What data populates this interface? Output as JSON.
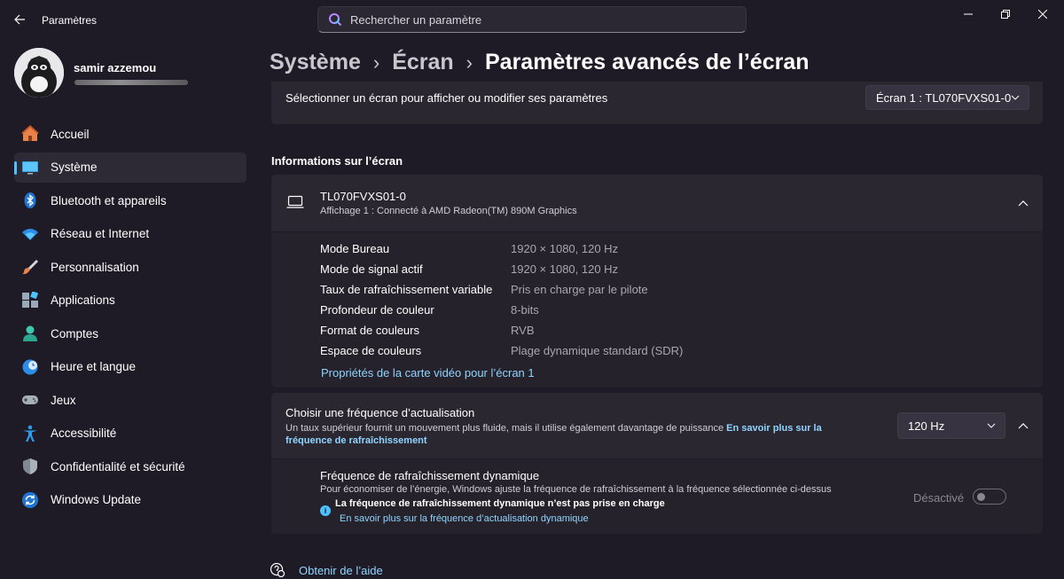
{
  "app": {
    "title": "Paramètres"
  },
  "search": {
    "placeholder": "Rechercher un paramètre"
  },
  "user": {
    "name": "samir azzemou"
  },
  "sidebar": {
    "items": [
      {
        "label": "Accueil",
        "icon": "home-icon"
      },
      {
        "label": "Système",
        "icon": "monitor-icon",
        "active": true
      },
      {
        "label": "Bluetooth et appareils",
        "icon": "bluetooth-icon"
      },
      {
        "label": "Réseau et Internet",
        "icon": "wifi-icon"
      },
      {
        "label": "Personnalisation",
        "icon": "brush-icon"
      },
      {
        "label": "Applications",
        "icon": "apps-icon"
      },
      {
        "label": "Comptes",
        "icon": "person-icon"
      },
      {
        "label": "Heure et langue",
        "icon": "globe-clock-icon"
      },
      {
        "label": "Jeux",
        "icon": "gamepad-icon"
      },
      {
        "label": "Accessibilité",
        "icon": "accessibility-icon"
      },
      {
        "label": "Confidentialité et sécurité",
        "icon": "shield-icon"
      },
      {
        "label": "Windows Update",
        "icon": "update-icon"
      }
    ]
  },
  "breadcrumb": {
    "level1": "Système",
    "level2": "Écran",
    "current": "Paramètres avancés de l’écran"
  },
  "display_select": {
    "label": "Sélectionner un écran pour afficher ou modifier ses paramètres",
    "value": "Écran 1 : TL070FVXS01-0"
  },
  "info_section": {
    "title": "Informations sur l’écran",
    "monitor_name": "TL070FVXS01-0",
    "monitor_sub": "Affichage 1 : Connecté à AMD Radeon(TM) 890M Graphics",
    "rows": [
      {
        "label": "Mode Bureau",
        "value": "1920 × 1080, 120 Hz"
      },
      {
        "label": "Mode de signal actif",
        "value": "1920 × 1080, 120 Hz"
      },
      {
        "label": "Taux de rafraîchissement variable",
        "value": "Pris en charge par le pilote"
      },
      {
        "label": "Profondeur de couleur",
        "value": "8-bits"
      },
      {
        "label": "Format de couleurs",
        "value": "RVB"
      },
      {
        "label": "Espace de couleurs",
        "value": "Plage dynamique standard (SDR)"
      }
    ],
    "link": "Propriétés de la carte vidéo pour l’écran 1"
  },
  "refresh": {
    "title": "Choisir une fréquence d’actualisation",
    "desc": "Un taux supérieur fournit un mouvement plus fluide, mais il utilise également davantage de puissance ",
    "link_line1": "En savoir plus sur la",
    "link_line2": "fréquence de rafraîchissement",
    "value": "120 Hz"
  },
  "dynamic": {
    "title": "Fréquence de rafraîchissement dynamique",
    "desc": "Pour économiser de l’énergie, Windows ajuste la fréquence de rafraîchissement à la fréquence sélectionnée ci-dessus",
    "note": "La fréquence de rafraîchissement dynamique n’est pas prise en charge",
    "link": "En savoir plus sur la fréquence d’actualisation dynamique",
    "toggle_label": "Désactivé"
  },
  "help": {
    "label": "Obtenir de l’aide"
  },
  "colors": {
    "accent": "#4cc2ff",
    "link": "#8fd4ff",
    "background": "#1f1b26",
    "card": "#2b2731"
  }
}
